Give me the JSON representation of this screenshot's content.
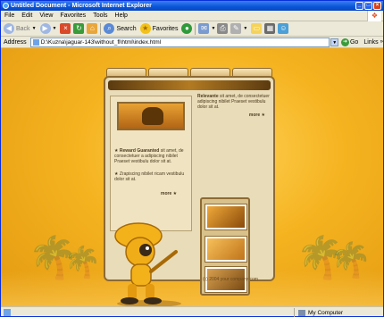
{
  "window": {
    "title": "Untitled Document - Microsoft Internet Explorer"
  },
  "menu": [
    "File",
    "Edit",
    "View",
    "Favorites",
    "Tools",
    "Help"
  ],
  "toolbar": {
    "back_label": "Back",
    "search_label": "Search",
    "favorites_label": "Favorites"
  },
  "address": {
    "label": "Address",
    "value": "D:\\Kuzna\\jaguar-143\\without_fl\\html\\index.html",
    "go_label": "Go",
    "links_label": "Links"
  },
  "page": {
    "right_text_lead": "Relevante",
    "right_text": " sit amet, de consectetuer adipiscing nibilet Praeset vestibulu dolor sit at.",
    "left_item1_lead": "Reward Guaranted",
    "left_item1": " sit amet, de consectetuer a adipiscing nibilet Praeset vestibulu dolor sit at.",
    "left_item2": "Zrapiscing nibilet ricam vestibulu dolor sit at.",
    "more_label": "more",
    "copyright": "(c) 2004 your company com"
  },
  "status": {
    "zone": "My Computer"
  },
  "colors": {
    "accent": "#0a55d8",
    "page_bg": "#f5b320",
    "panel": "#e9dcb8"
  }
}
